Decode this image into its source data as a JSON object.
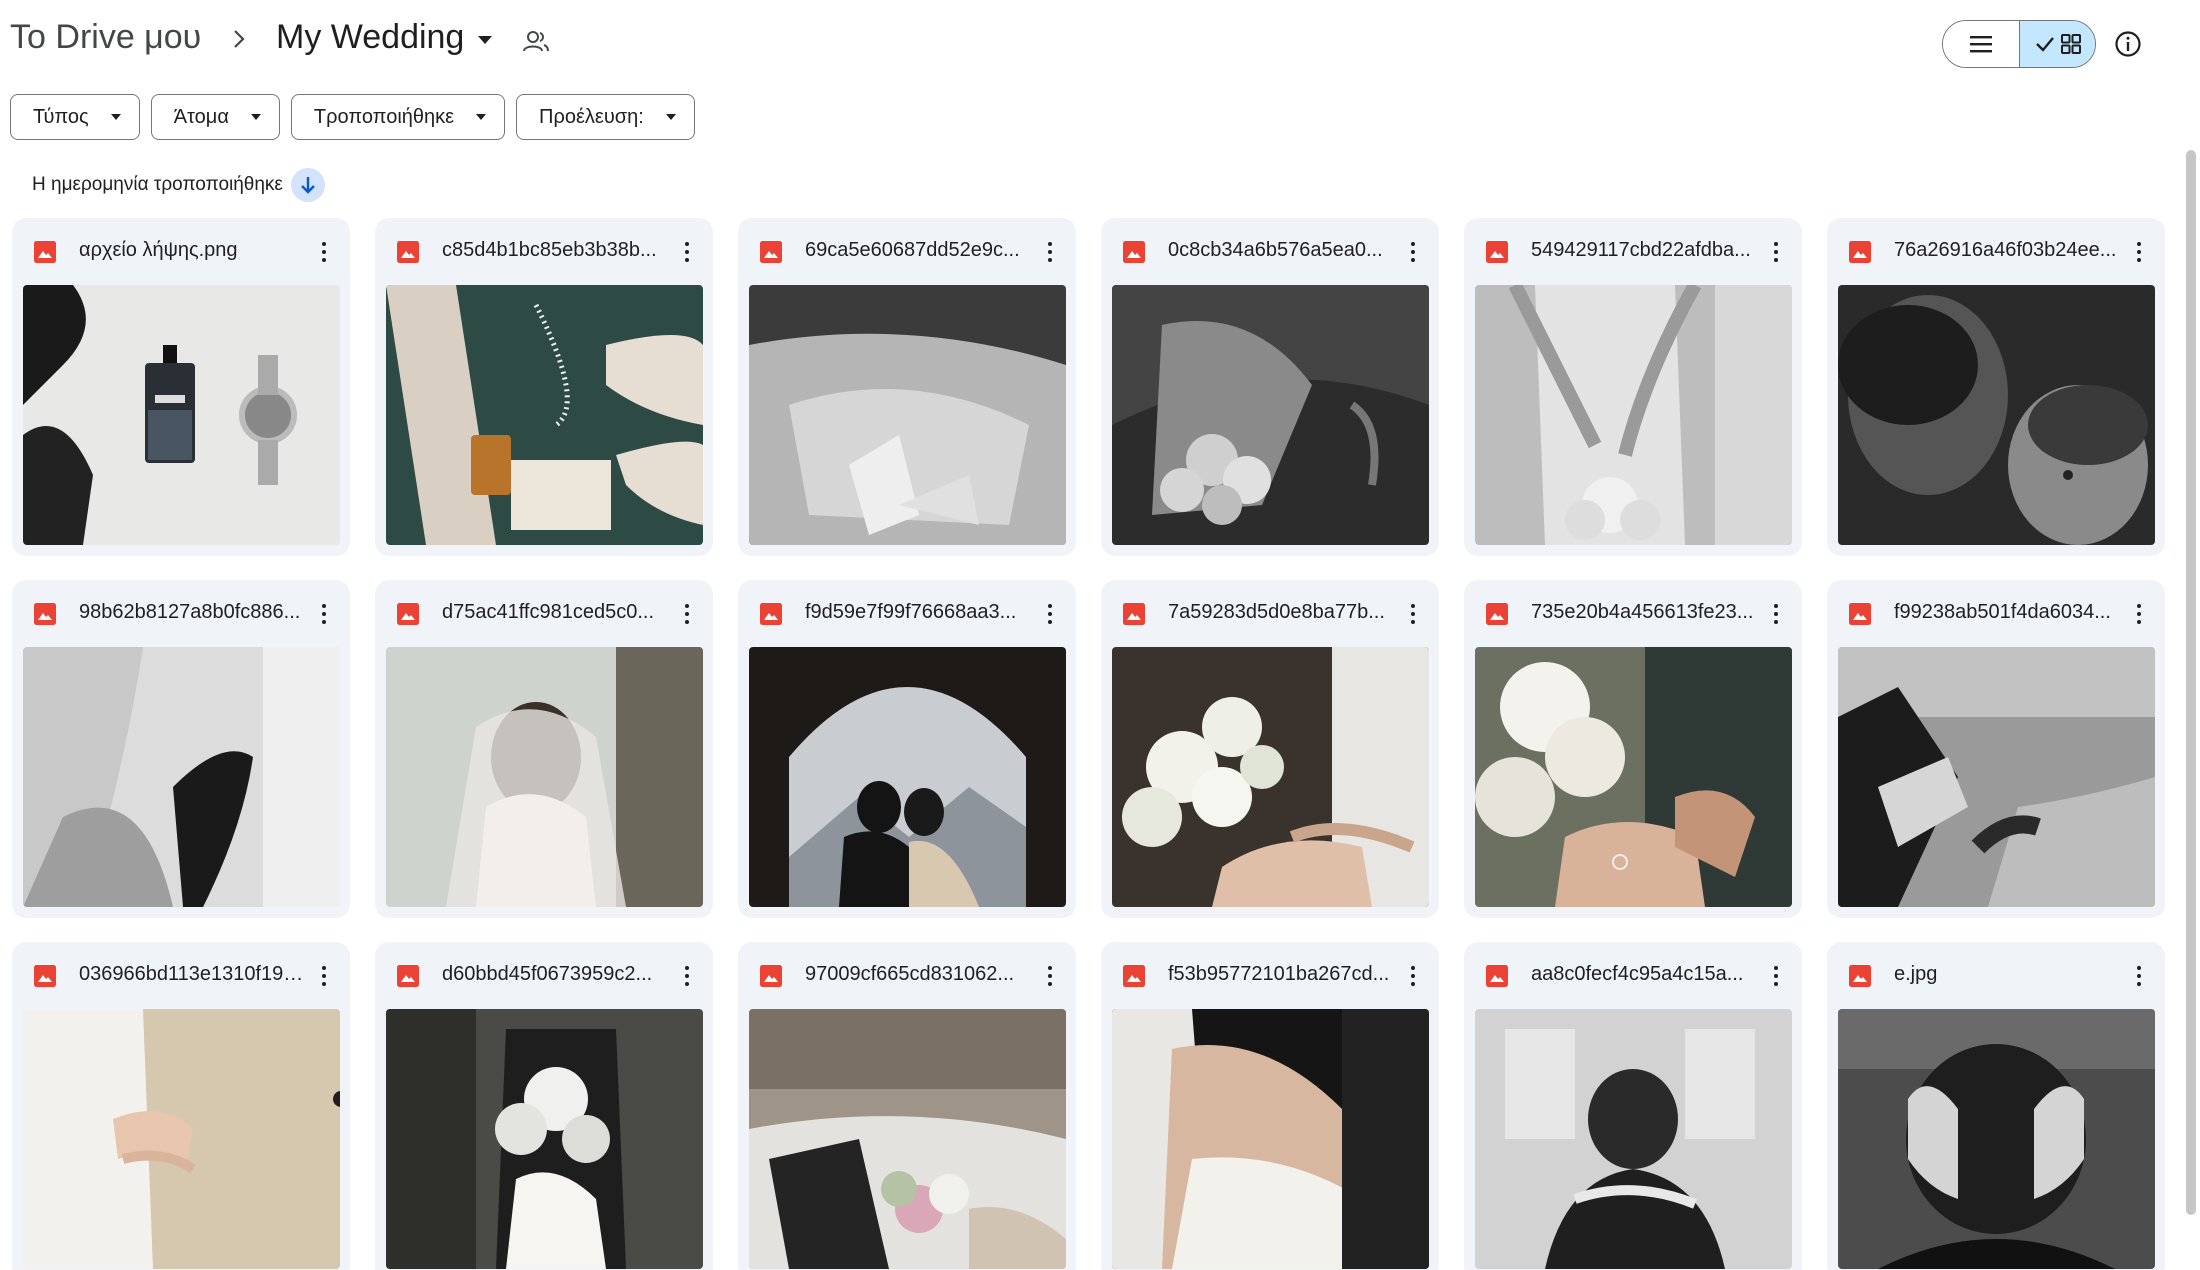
{
  "breadcrumb": {
    "root": "Το Drive μου",
    "current": "My Wedding"
  },
  "icons": {
    "separator": "chevron-right-icon",
    "share": "shared-people-icon",
    "list_view": "list-view-icon",
    "grid_view": "grid-view-icon",
    "info": "info-icon",
    "file": "image-file-icon",
    "more": "more-vert-icon",
    "sort": "arrow-down-icon"
  },
  "colors": {
    "image_icon": "#ea4335",
    "grid_selected_bg": "#c2e7ff",
    "sort_bg": "#d3e3fd",
    "card_bg": "#f0f4f9"
  },
  "filters": [
    {
      "label": "Τύπος"
    },
    {
      "label": "Άτομα"
    },
    {
      "label": "Τροποποιήθηκε"
    },
    {
      "label": "Προέλευση:"
    }
  ],
  "sort": {
    "label": "Η ημερομηνία τροποποιήθηκε",
    "direction": "descending"
  },
  "files": [
    {
      "name": "αρχείο λήψης.png",
      "thumb": "perfume bottle and watch on white background"
    },
    {
      "name": "c85d4b1bc85eb3b38b...",
      "thumb": "pearl necklace, bridal shoes, perfume on green"
    },
    {
      "name": "69ca5e60687dd52e9c...",
      "thumb": "black and white veil and shoes"
    },
    {
      "name": "0c8cb34a6b576a5ea0...",
      "thumb": "black and white bouquet with veil"
    },
    {
      "name": "549429117cbd22afdba...",
      "thumb": "black and white bride holding bouquet behind back"
    },
    {
      "name": "76a26916a46f03b24ee...",
      "thumb": "black and white couple close-up"
    },
    {
      "name": "98b62b8127a8b0fc886...",
      "thumb": "black and white hand holding veil"
    },
    {
      "name": "d75ac41ffc981ced5c0...",
      "thumb": "bride with veil by window"
    },
    {
      "name": "f9d59e7f99f76668aa3...",
      "thumb": "couple silhouette in arch with mountains"
    },
    {
      "name": "7a59283d5d0e8ba77b...",
      "thumb": "white bouquet and holding hands"
    },
    {
      "name": "735e20b4a456613fe23...",
      "thumb": "holding hands with rings"
    },
    {
      "name": "f99238ab501f4da6034...",
      "thumb": "black and white holding hands"
    },
    {
      "name": "036966bd113e1310f191...",
      "thumb": "bride and groom embrace"
    },
    {
      "name": "d60bbd45f0673959c2...",
      "thumb": "couple kissing behind bouquet"
    },
    {
      "name": "97009cf665cd831062...",
      "thumb": "couple lying with bouquet"
    },
    {
      "name": "f53b95772101ba267cd...",
      "thumb": "bride back with veil"
    },
    {
      "name": "aa8c0fecf4c95a4c15a...",
      "thumb": "black and white embrace from behind"
    },
    {
      "name": "e.jpg",
      "thumb": "black and white hands with rings on head"
    }
  ]
}
